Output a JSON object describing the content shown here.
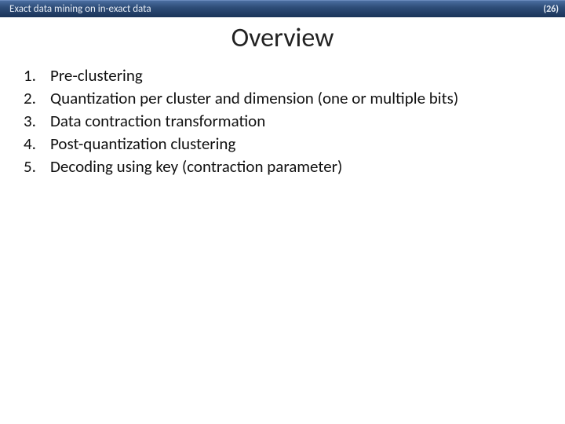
{
  "header": {
    "title": "Exact data mining on in-exact data",
    "page_indicator": "(26)"
  },
  "slide": {
    "title": "Overview",
    "steps": [
      "Pre-clustering",
      "Quantization per cluster and dimension (one or multiple bits)",
      "Data contraction transformation",
      "Post-quantization clustering",
      "Decoding using key (contraction parameter)"
    ]
  }
}
